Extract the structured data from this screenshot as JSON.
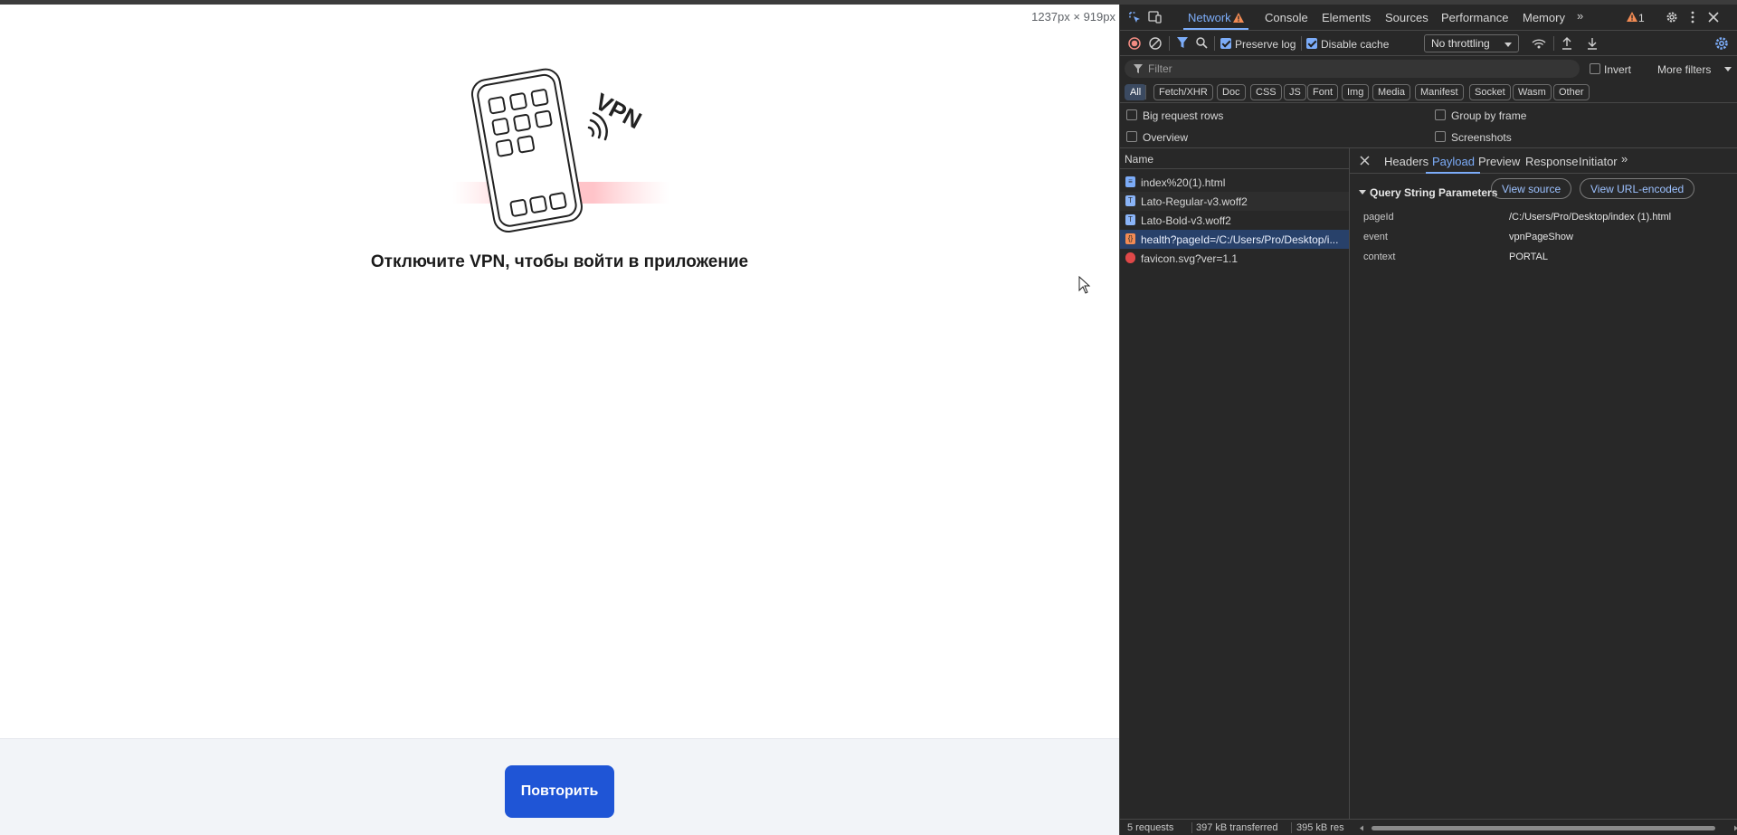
{
  "page": {
    "dims": "1237px × 919px",
    "illustration_text": "VPN",
    "message": "Отключите VPN, чтобы войти в приложение",
    "retry_label": "Повторить"
  },
  "devtools": {
    "tabs": [
      "Network",
      "Console",
      "Elements",
      "Sources",
      "Performance",
      "Memory"
    ],
    "issues_count": "1",
    "toolbar": {
      "preserve_log": "Preserve log",
      "disable_cache": "Disable cache",
      "throttling": "No throttling"
    },
    "filter": {
      "placeholder": "Filter",
      "invert": "Invert",
      "more_filters": "More filters"
    },
    "types": [
      "All",
      "Fetch/XHR",
      "Doc",
      "CSS",
      "JS",
      "Font",
      "Img",
      "Media",
      "Manifest",
      "Socket",
      "Wasm",
      "Other"
    ],
    "options": {
      "big_rows": "Big request rows",
      "group_by_frame": "Group by frame",
      "overview": "Overview",
      "screenshots": "Screenshots"
    },
    "requests_header": "Name",
    "requests": [
      "index%20(1).html",
      "Lato-Regular-v3.woff2",
      "Lato-Bold-v3.woff2",
      "health?pageId=/C:/Users/Pro/Desktop/i...",
      "favicon.svg?ver=1.1"
    ],
    "detail": {
      "tabs": [
        "Headers",
        "Payload",
        "Preview",
        "Response",
        "Initiator"
      ],
      "section": "Query String Parameters",
      "view_source": "View source",
      "view_url_encoded": "View URL-encoded",
      "params": [
        {
          "key": "pageId",
          "value": "/C:/Users/Pro/Desktop/index (1).html"
        },
        {
          "key": "event",
          "value": "vpnPageShow"
        },
        {
          "key": "context",
          "value": "PORTAL"
        }
      ]
    },
    "status": {
      "requests": "5 requests",
      "transferred": "397 kB transferred",
      "resources": "395 kB res"
    },
    "colors": {
      "accent": "#7cacf8",
      "panel_bg": "#282828",
      "selected_row": "#28416a",
      "retry_button": "#1f55d6",
      "warning": "#f28b54"
    }
  }
}
